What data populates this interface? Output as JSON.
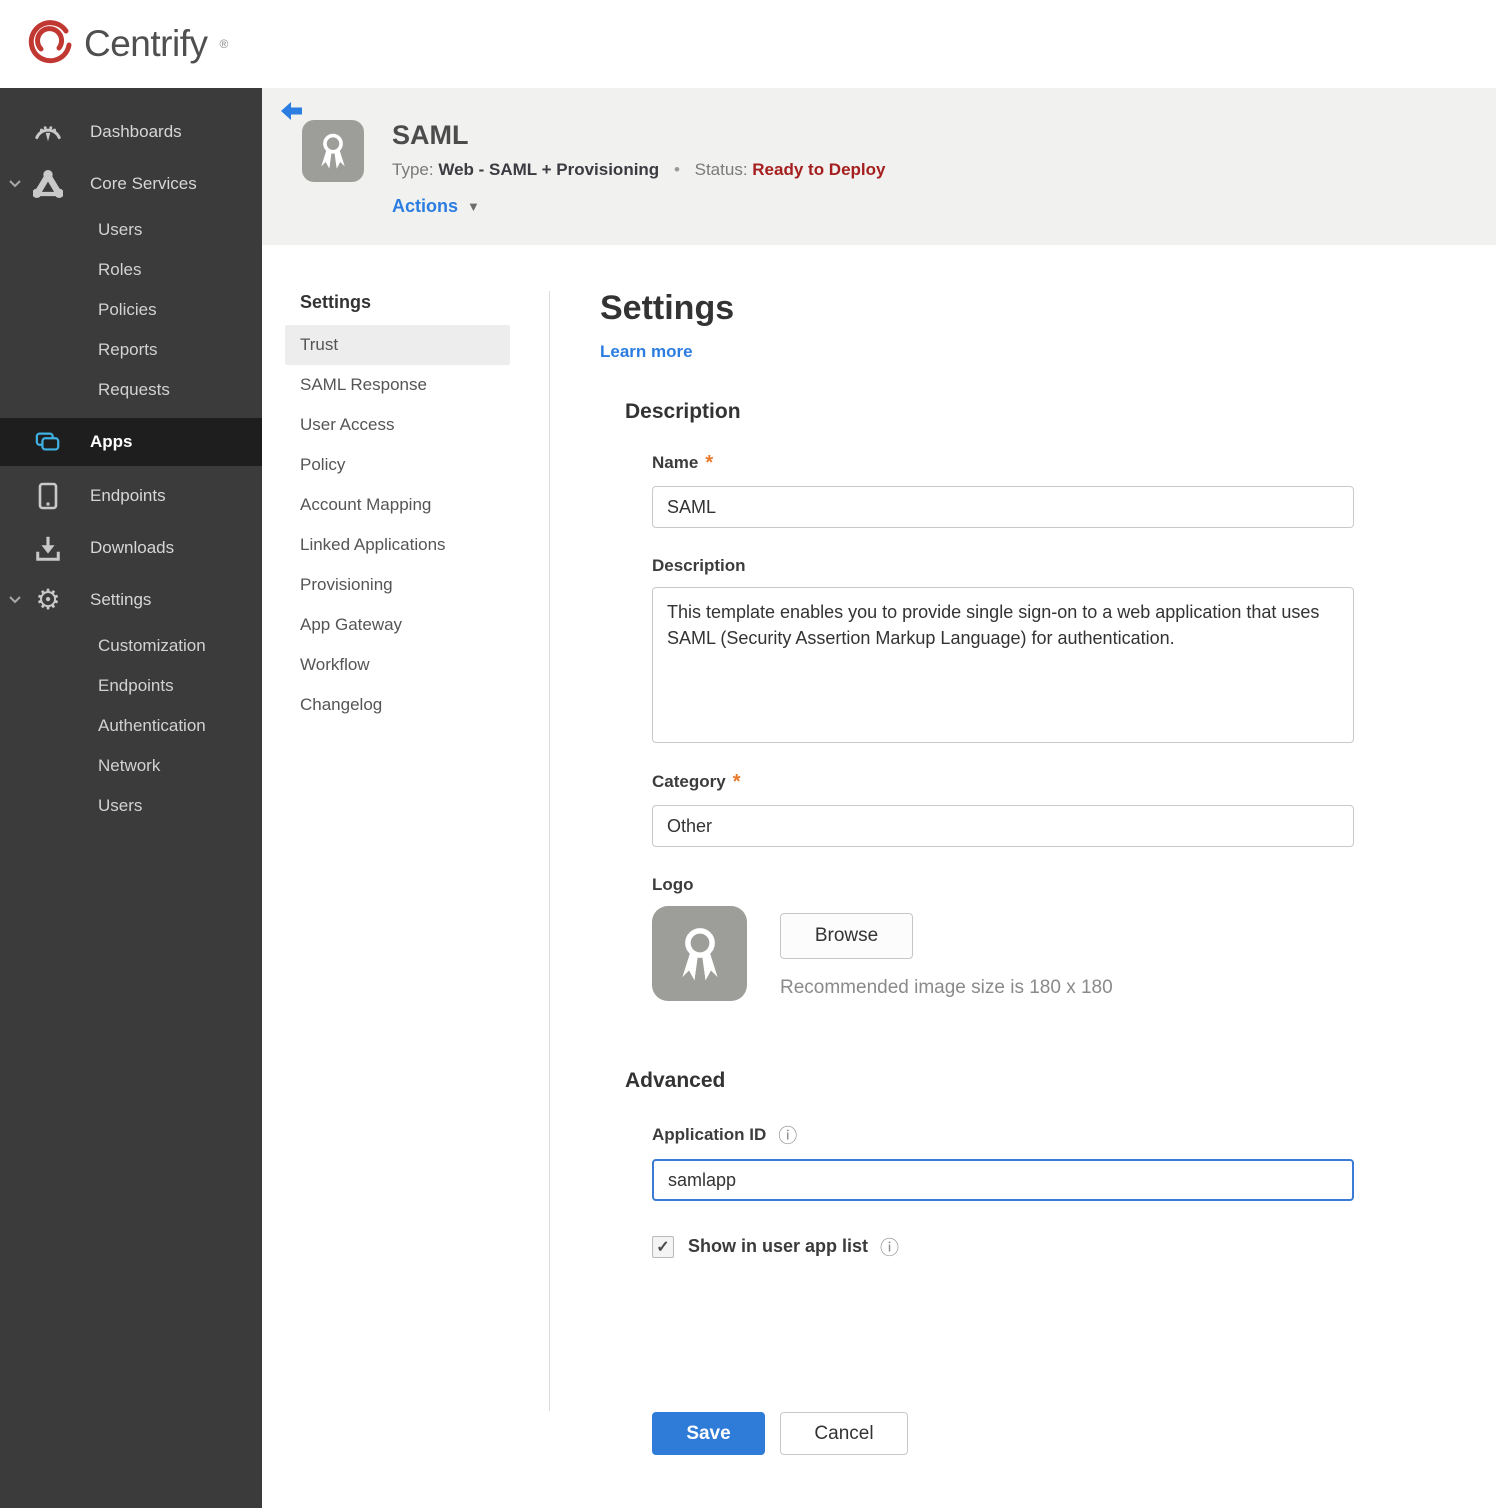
{
  "brand": {
    "name": "Centrify",
    "registered": "®"
  },
  "sidebar": {
    "dashboards": "Dashboards",
    "core_services": "Core Services",
    "core_items": [
      "Users",
      "Roles",
      "Policies",
      "Reports",
      "Requests"
    ],
    "apps": "Apps",
    "endpoints": "Endpoints",
    "downloads": "Downloads",
    "settings": "Settings",
    "settings_items": [
      "Customization",
      "Endpoints",
      "Authentication",
      "Network",
      "Users"
    ],
    "gear_glyph": "⚙"
  },
  "header": {
    "title": "SAML",
    "type_label": "Type:",
    "type_value": "Web - SAML + Provisioning",
    "separator": "•",
    "status_label": "Status:",
    "status_value": "Ready to Deploy",
    "actions_label": "Actions",
    "actions_caret": "▼"
  },
  "subnav": {
    "heading": "Settings",
    "active_item": "Trust",
    "items": [
      "Trust",
      "SAML Response",
      "User Access",
      "Policy",
      "Account Mapping",
      "Linked Applications",
      "Provisioning",
      "App Gateway",
      "Workflow",
      "Changelog"
    ]
  },
  "form": {
    "title": "Settings",
    "learn_more": "Learn more",
    "description_section": "Description",
    "name_label": "Name",
    "required_marker": "*",
    "name_value": "SAML",
    "description_label": "Description",
    "description_value": "This template enables you to provide single sign-on to a web application that uses SAML (Security Assertion Markup Language) for authentication.",
    "category_label": "Category",
    "category_value": "Other",
    "logo_label": "Logo",
    "browse_button": "Browse",
    "logo_hint": "Recommended image size is 180 x 180",
    "advanced_section": "Advanced",
    "app_id_label": "Application ID",
    "app_id_value": "samlapp",
    "show_in_list_label": "Show in user app list",
    "show_in_list_checked": "✓",
    "info_glyph": "ⓘ",
    "save_button": "Save",
    "cancel_button": "Cancel"
  },
  "colors": {
    "brand_red": "#c13832",
    "accent_blue": "#2f7cd8",
    "link_blue": "#2b7de1",
    "status_red": "#a51f1f",
    "apps_icon_cyan": "#3fb1e3",
    "required_orange": "#e8782a",
    "sidebar_bg": "#3b3b3b",
    "sidebar_active_bg": "#1e1e1e",
    "header_band_bg": "#f1f1ef"
  }
}
